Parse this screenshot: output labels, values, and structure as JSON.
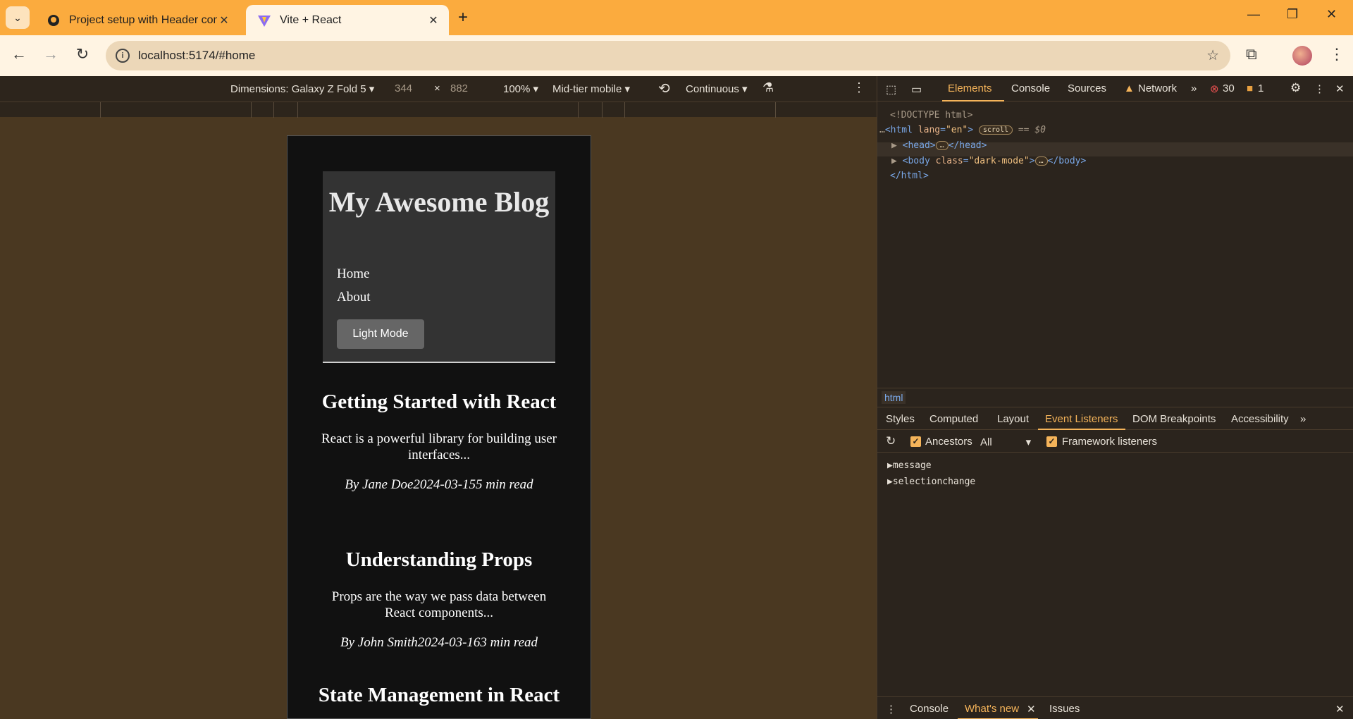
{
  "browser": {
    "tabs": [
      {
        "title": "Project setup with Header comp",
        "icon": "github-icon"
      },
      {
        "title": "Vite + React",
        "icon": "vite-icon"
      }
    ],
    "url": "localhost:5174/#home"
  },
  "device_toolbar": {
    "dimensions": "Dimensions: Galaxy Z Fold 5",
    "width": "344",
    "times": "×",
    "height": "882",
    "zoom": "100%",
    "throttle": "Mid-tier mobile",
    "mode": "Continuous"
  },
  "page": {
    "blog_title": "My Awesome Blog",
    "nav": [
      "Home",
      "About"
    ],
    "mode_button": "Light Mode",
    "posts": [
      {
        "title": "Getting Started with React",
        "excerpt": "React is a powerful library for building user interfaces...",
        "meta": "By Jane Doe2024-03-155 min read"
      },
      {
        "title": "Understanding Props",
        "excerpt": "Props are the way we pass data between React components...",
        "meta": "By John Smith2024-03-163 min read"
      },
      {
        "title": "State Management in React",
        "excerpt": "",
        "meta": ""
      }
    ]
  },
  "devtools": {
    "tabs": [
      "Elements",
      "Console",
      "Sources",
      "Network"
    ],
    "errors": "30",
    "warnings": "1",
    "dom": {
      "doctype": "<!DOCTYPE html>",
      "html_open": "<html",
      "html_attr": "lang",
      "html_val": "\"en\"",
      "scroll_badge": "scroll",
      "sel_marker": "== $0",
      "head_open": "<head>",
      "head_close": "</head>",
      "body_open": "<body",
      "body_attr": "class",
      "body_val": "\"dark-mode\"",
      "body_close": "</body>",
      "html_close": "</html>"
    },
    "breadcrumb": "html",
    "subtabs": [
      "Styles",
      "Computed",
      "Layout",
      "Event Listeners",
      "DOM Breakpoints",
      "Accessibility"
    ],
    "filter": {
      "ancestors": "Ancestors",
      "select": "All",
      "framework": "Framework listeners"
    },
    "listeners": [
      "message",
      "selectionchange"
    ],
    "drawer": [
      "Console",
      "What's new",
      "Issues"
    ]
  },
  "colors": {
    "accent": "#f5b45a",
    "chrome": "#fbab3e",
    "device_bg": "#111111"
  }
}
